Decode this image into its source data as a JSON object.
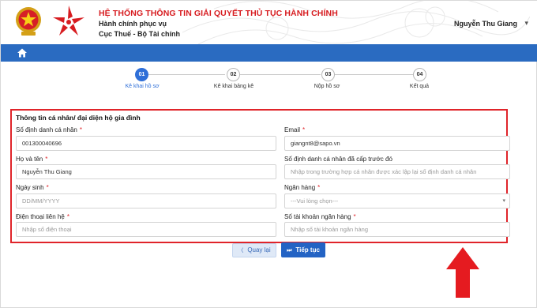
{
  "header": {
    "system_title": "HỆ THỐNG THÔNG TIN GIẢI QUYẾT THỦ TỤC HÀNH CHÍNH",
    "org_line1": "Hành chính phục vụ",
    "org_line2": "Cục Thuế - Bộ Tài chính",
    "user_name": "Nguyễn Thu Giang",
    "emblem_icon": "national-emblem-icon",
    "logo_icon": "star-logo-icon",
    "user_menu_icon": "chevron-down-icon"
  },
  "nav": {
    "home_icon": "home-icon"
  },
  "steps": [
    {
      "number": "01",
      "label": "Kê khai hồ sơ",
      "active": true
    },
    {
      "number": "02",
      "label": "Kê khai bảng kê",
      "active": false
    },
    {
      "number": "03",
      "label": "Nộp hồ sơ",
      "active": false
    },
    {
      "number": "04",
      "label": "Kết quả",
      "active": false
    }
  ],
  "form": {
    "section_title": "Thông tin cá nhân/ đại diện hộ gia đình",
    "required_marker": "*",
    "fields": {
      "id_number": {
        "label": "Số định danh cá nhân",
        "value": "001300040696"
      },
      "email": {
        "label": "Email",
        "value": "giangnt8@sapo.vn"
      },
      "full_name": {
        "label": "Họ và tên",
        "value": "Nguyễn Thu Giang"
      },
      "previous_id": {
        "label": "Số định danh cá nhân đã cấp trước đó",
        "placeholder": "Nhập trong trường hợp cá nhân được xác lập lại số định danh cá nhân"
      },
      "dob": {
        "label": "Ngày sinh",
        "placeholder": "DD/MM/YYYY"
      },
      "bank": {
        "label": "Ngân hàng",
        "placeholder": "---Vui lòng chọn---"
      },
      "phone": {
        "label": "Điện thoại liên hệ",
        "placeholder": "Nhập số điện thoại"
      },
      "bank_account": {
        "label": "Số tài khoản ngân hàng",
        "placeholder": "Nhập số tài khoản ngân hàng"
      }
    }
  },
  "buttons": {
    "back_label": "Quay lại",
    "back_icon": "chevron-left-icon",
    "next_label": "Tiếp tục",
    "next_icon": "fast-forward-icon"
  },
  "colors": {
    "brand_red": "#d71c20",
    "nav_blue": "#2a6bc1",
    "step_active": "#2f6fd8",
    "highlight_border": "#e0242a",
    "annotation_arrow": "#e51b20"
  }
}
